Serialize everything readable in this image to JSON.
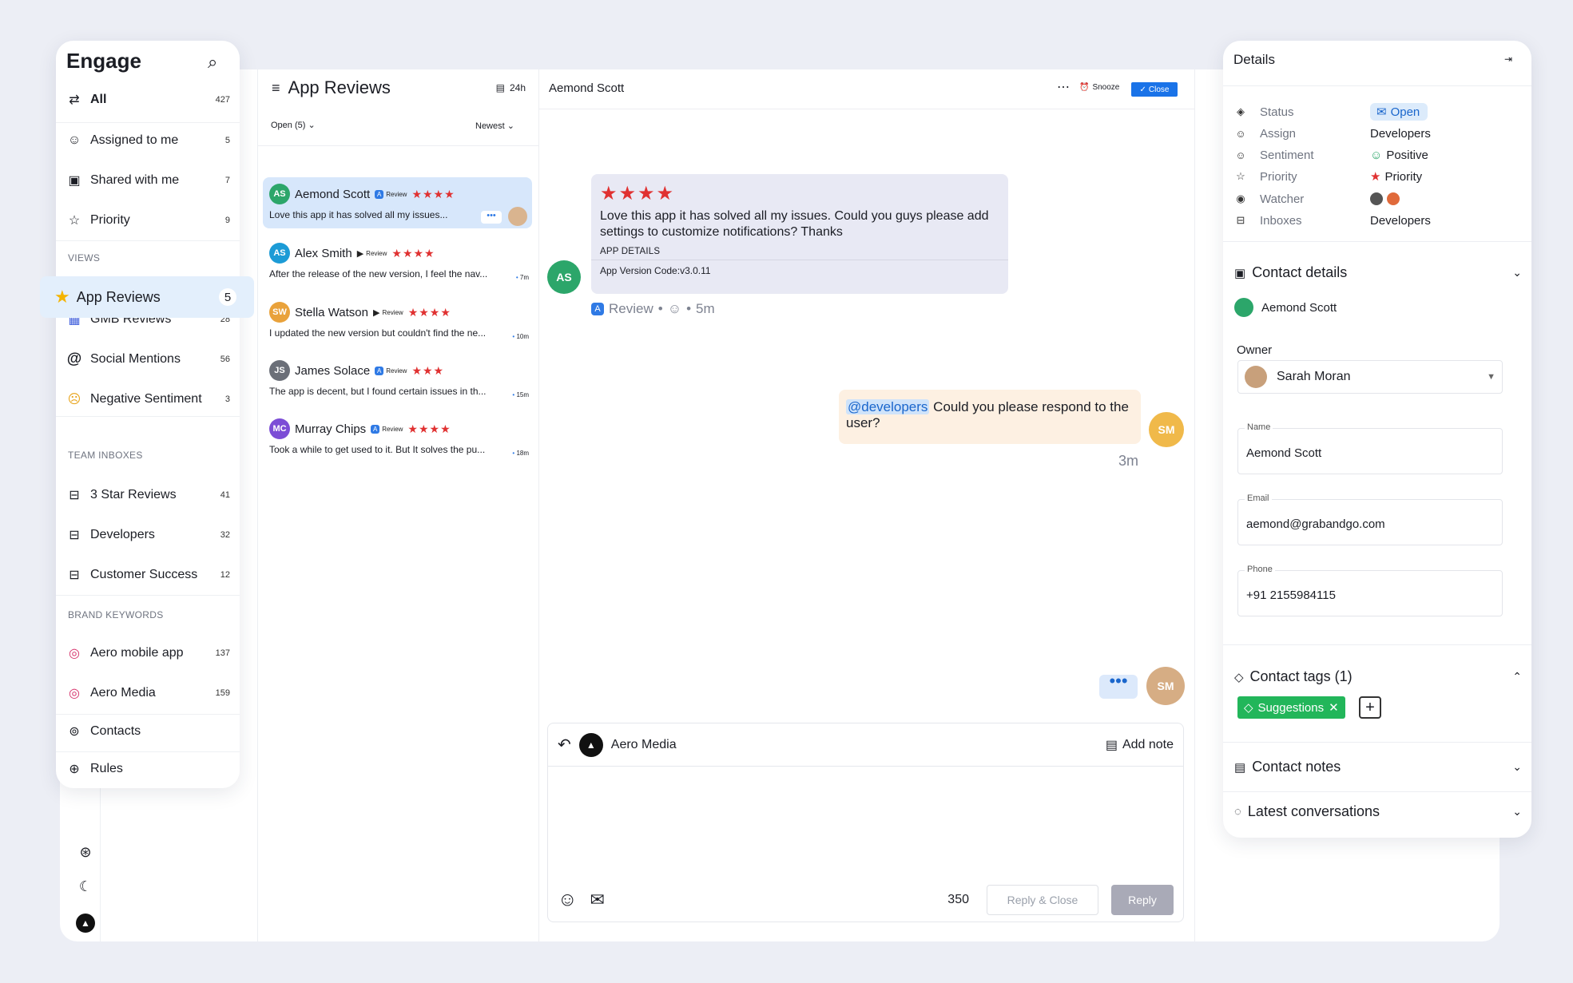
{
  "nav": {
    "title": "Engage",
    "items": [
      {
        "label": "All",
        "count": "427"
      },
      {
        "label": "Assigned to me",
        "count": "5"
      },
      {
        "label": "Shared with me",
        "count": "7"
      },
      {
        "label": "Priority",
        "count": "9"
      }
    ],
    "views_title": "VIEWS",
    "active": {
      "label": "App Reviews",
      "count": "5"
    },
    "views": [
      {
        "label": "GMB Reviews",
        "count": "28"
      },
      {
        "label": "Social Mentions",
        "count": "56"
      },
      {
        "label": "Negative Sentiment",
        "count": "3"
      }
    ],
    "team_title": "TEAM INBOXES",
    "team": [
      {
        "label": "3 Star Reviews",
        "count": "41"
      },
      {
        "label": "Developers",
        "count": "32"
      },
      {
        "label": "Customer Success",
        "count": "12"
      }
    ],
    "brand_title": "BRAND KEYWORDS",
    "brand": [
      {
        "label": "Aero mobile app",
        "count": "137"
      },
      {
        "label": "Aero Media",
        "count": "159"
      }
    ],
    "contacts": "Contacts",
    "rules": "Rules"
  },
  "list": {
    "title": "App Reviews",
    "range": "24h",
    "filter": "Open (5)",
    "sort": "Newest",
    "reviews": [
      {
        "name": "Aemond Scott",
        "source": "Review",
        "stars": "★★★★",
        "text": "Love this app it has solved all my issues...",
        "time": ""
      },
      {
        "name": "Alex Smith",
        "source": "Review",
        "stars": "★★★★",
        "text": "After the release of the new version, I feel the nav...",
        "time": "7m"
      },
      {
        "name": "Stella Watson",
        "source": "Review",
        "stars": "★★★★",
        "text": "I updated the new version but couldn't find the ne...",
        "time": "10m"
      },
      {
        "name": "James Solace",
        "source": "Review",
        "stars": "★★★",
        "text": "The app is decent, but I found certain issues in th...",
        "time": "15m"
      },
      {
        "name": "Murray Chips",
        "source": "Review",
        "stars": "★★★★",
        "text": "Took a while to get used to it. But It solves the pu...",
        "time": "18m"
      }
    ]
  },
  "conv": {
    "name": "Aemond Scott",
    "snooze": "Snooze",
    "close": "Close",
    "incoming": {
      "stars": "★★★★",
      "text": "Love this app it has solved all my issues. Could you guys please add settings to customize notifications? Thanks",
      "details_title": "APP DETAILS",
      "version": "App Version Code:v3.0.11",
      "source": "Review",
      "time": "5m"
    },
    "outgoing": {
      "mention": "@developers",
      "text": " Could you please respond to the user?",
      "time": "3m"
    },
    "composer": {
      "account": "Aero Media",
      "add_note": "Add note",
      "char_count": "350",
      "reply_close": "Reply & Close",
      "reply": "Reply"
    }
  },
  "details": {
    "title": "Details",
    "rows": [
      {
        "label": "Status",
        "value": "Open"
      },
      {
        "label": "Assign",
        "value": "Developers"
      },
      {
        "label": "Sentiment",
        "value": "Positive"
      },
      {
        "label": "Priority",
        "value": "Priority"
      },
      {
        "label": "Watcher",
        "value": ""
      },
      {
        "label": "Inboxes",
        "value": "Developers"
      }
    ],
    "contact_title": "Contact details",
    "contact_name": "Aemond Scott",
    "owner_label": "Owner",
    "owner": "Sarah Moran",
    "fields": [
      {
        "label": "Name",
        "value": "Aemond Scott"
      },
      {
        "label": "Email",
        "value": "aemond@grabandgo.com"
      },
      {
        "label": "Phone",
        "value": "+91 2155984115"
      }
    ],
    "tags_title": "Contact tags (1)",
    "tag": "Suggestions",
    "notes_title": "Contact notes",
    "latest_title": "Latest conversations"
  },
  "colors": {
    "accent": "#1a73e8",
    "active_bg": "#e3effc",
    "star": "#e03131",
    "tag": "#22b65a"
  }
}
